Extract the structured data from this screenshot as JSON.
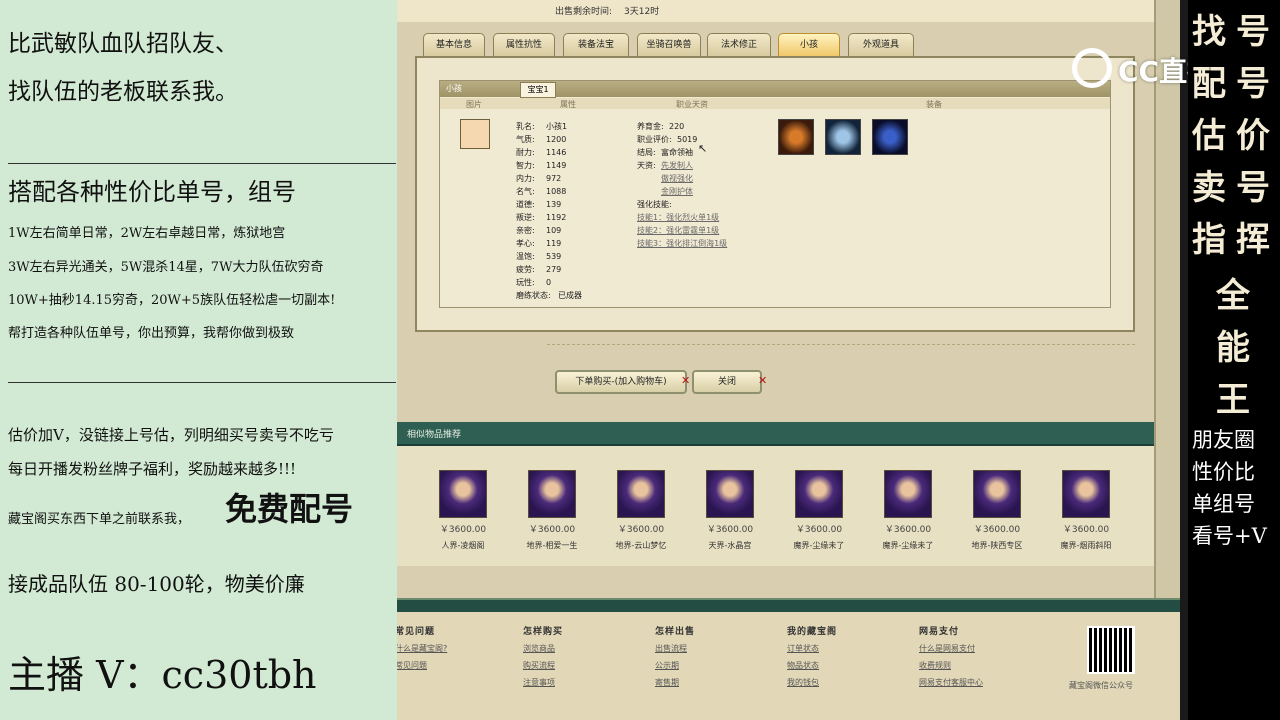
{
  "left_panel": {
    "line1": "比武敏队血队招队友、",
    "line2": "找队伍的老板联系我。",
    "line3": "搭配各种性价比单号，组号",
    "line4": "1W左右简单日常，2W左右卓越日常，炼狱地宫",
    "line5": "3W左右异光通关，5W混杀14星，7W大力队伍砍穷奇",
    "line6": "10W+抽秒14.15穷奇，20W+5族队伍轻松虐一切副本!",
    "line7": "帮打造各种队伍单号，你出预算，我帮你做到极致",
    "line8": "估价加V，没链接上号估，列明细买号卖号不吃亏",
    "line9": "每日开播发粉丝牌子福利，奖励越来越多!!!",
    "line10": "藏宝阁买东西下单之前联系我，",
    "line10_big": "免费配号",
    "line11": "接成品队伍 80-100轮，物美价廉",
    "line12": "主播 V：cc30tbh"
  },
  "header": {
    "sell_label": "出售剩余时间:",
    "sell_value": "3天12时"
  },
  "tabs": [
    "基本信息",
    "属性抗性",
    "装备法宝",
    "坐骑召唤兽",
    "法术修正",
    "小孩",
    "外观道具"
  ],
  "active_tab": "小孩",
  "child_panel": {
    "title": "小孩",
    "subtab": "宝宝1",
    "columns": [
      "图片",
      "属性",
      "职业天资",
      "装备"
    ],
    "stats": [
      {
        "k": "乳名:",
        "v": "小孩1"
      },
      {
        "k": "气质:",
        "v": "1200"
      },
      {
        "k": "耐力:",
        "v": "1146"
      },
      {
        "k": "智力:",
        "v": "1149"
      },
      {
        "k": "内力:",
        "v": "972"
      },
      {
        "k": "名气:",
        "v": "1088"
      },
      {
        "k": "道德:",
        "v": "139"
      },
      {
        "k": "叛逆:",
        "v": "1192"
      },
      {
        "k": "亲密:",
        "v": "109"
      },
      {
        "k": "孝心:",
        "v": "119"
      },
      {
        "k": "温饱:",
        "v": "539"
      },
      {
        "k": "疲劳:",
        "v": "279"
      },
      {
        "k": "玩性:",
        "v": "0"
      },
      {
        "k": "磨练状态:",
        "v": "已成器"
      }
    ],
    "career": [
      {
        "k": "养育金:",
        "v": "220"
      },
      {
        "k": "职业评价:",
        "v": "5019"
      },
      {
        "k": "结局:",
        "v": "富命领袖"
      }
    ],
    "talent_label": "天资:",
    "talents": [
      "先发制人",
      "傲视强化",
      "金刚护体"
    ],
    "skill_label": "强化技能:",
    "skills": [
      "技能1：强化烈火单1级",
      "技能2：强化雷霆单1级",
      "技能3：强化排江倒海1级"
    ]
  },
  "buttons": {
    "buy": "下单购买-(加入购物车)",
    "close": "关闭"
  },
  "recommend": {
    "title": "相似物品推荐",
    "items": [
      {
        "price": "￥3600.00",
        "server": "人界-凌烟阁"
      },
      {
        "price": "￥3600.00",
        "server": "地界-相爱一生"
      },
      {
        "price": "￥3600.00",
        "server": "地界-云山梦忆"
      },
      {
        "price": "￥3600.00",
        "server": "天界-水晶宫"
      },
      {
        "price": "￥3600.00",
        "server": "魔界-尘缘未了"
      },
      {
        "price": "￥3600.00",
        "server": "魔界-尘缘未了"
      },
      {
        "price": "￥3600.00",
        "server": "地界-陕西专区"
      },
      {
        "price": "￥3600.00",
        "server": "魔界-烟雨斜阳"
      }
    ]
  },
  "footer": {
    "cols": [
      {
        "h": "常见问题",
        "links": [
          "什么是藏宝阁?",
          "常见问题"
        ]
      },
      {
        "h": "怎样购买",
        "links": [
          "浏览商品",
          "购买流程",
          "注意事项"
        ]
      },
      {
        "h": "怎样出售",
        "links": [
          "出售流程",
          "公示期",
          "寄售期"
        ]
      },
      {
        "h": "我的藏宝阁",
        "links": [
          "订单状态",
          "物品状态",
          "我的钱包"
        ]
      },
      {
        "h": "网易支付",
        "links": [
          "什么是网易支付",
          "收费规则",
          "网易支付客服中心"
        ]
      }
    ],
    "qr_label": "藏宝阁微信公众号"
  },
  "watermark": "CC直播",
  "right_panel": {
    "col1": [
      "找",
      "配",
      "估",
      "卖",
      "指"
    ],
    "col2": [
      "号",
      "号",
      "价",
      "号",
      "挥"
    ],
    "center": [
      "全",
      "能",
      "王"
    ],
    "lines": [
      "朋友圈",
      "性价比",
      "单组号",
      "看号+V"
    ]
  },
  "colors": {
    "left_bg": "#d2ead3",
    "right_bg": "#000000",
    "active_tab": "#f0c86a",
    "rec_bar": "#2f5f52"
  }
}
